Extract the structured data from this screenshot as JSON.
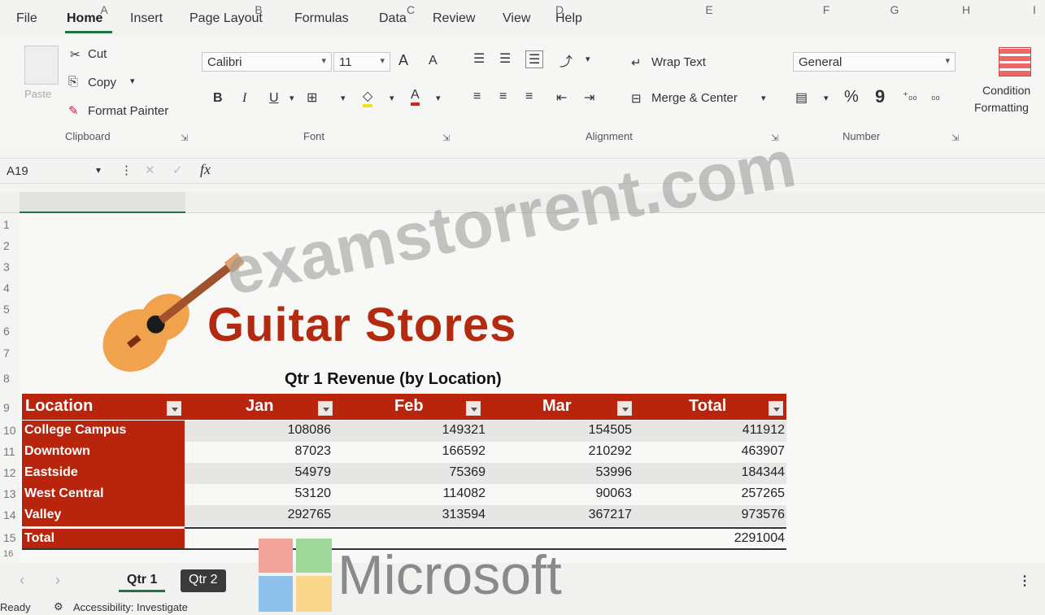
{
  "menu": {
    "items": [
      "File",
      "Home",
      "Insert",
      "Page Layout",
      "Formulas",
      "Data",
      "Review",
      "View",
      "Help"
    ]
  },
  "ribbon": {
    "clipboard": {
      "paste": "Paste",
      "cut": "Cut",
      "copy": "Copy",
      "format_painter": "Format Painter",
      "label": "Clipboard"
    },
    "font": {
      "name": "Calibri",
      "size": "11",
      "label": "Font",
      "bold": "B",
      "italic": "I",
      "underline": "U",
      "grow": "A",
      "shrink": "A"
    },
    "alignment": {
      "wrap_text": "Wrap Text",
      "merge_center": "Merge & Center",
      "label": "Alignment"
    },
    "number": {
      "format": "General",
      "percent": "%",
      "comma": "9",
      "label": "Number"
    },
    "conditional": {
      "line1": "Condition",
      "line2": "Formatting"
    }
  },
  "formula_bar": {
    "name_box": "A19",
    "fx": "fx",
    "value": ""
  },
  "columns": [
    "A",
    "B",
    "C",
    "D",
    "E",
    "F",
    "G",
    "H",
    "I"
  ],
  "rows": [
    "1",
    "2",
    "3",
    "4",
    "5",
    "6",
    "7",
    "8",
    "9",
    "10",
    "11",
    "12",
    "13",
    "14",
    "15",
    "16"
  ],
  "sheet": {
    "title": "Guitar Stores",
    "subtitle": "Qtr 1 Revenue (by Location)",
    "watermark": "examstorrent.com",
    "table": {
      "headers": [
        "Location",
        "Jan",
        "Feb",
        "Mar",
        "Total"
      ],
      "rows": [
        {
          "location": "College Campus",
          "jan": "108086",
          "feb": "149321",
          "mar": "154505",
          "total": "411912"
        },
        {
          "location": "Downtown",
          "jan": "87023",
          "feb": "166592",
          "mar": "210292",
          "total": "463907"
        },
        {
          "location": "Eastside",
          "jan": "54979",
          "feb": "75369",
          "mar": "53996",
          "total": "184344"
        },
        {
          "location": "West Central",
          "jan": "53120",
          "feb": "114082",
          "mar": "90063",
          "total": "257265"
        },
        {
          "location": "Valley",
          "jan": "292765",
          "feb": "313594",
          "mar": "367217",
          "total": "973576"
        }
      ],
      "total_label": "Total",
      "grand_total": "2291004"
    }
  },
  "tabs": [
    "Qtr 1",
    "Qtr 2"
  ],
  "status": {
    "ready": "Ready",
    "accessibility": "Accessibility: Investigate"
  },
  "brand": {
    "microsoft": "Microsoft"
  },
  "colors": {
    "table_header": "#b8240c",
    "title": "#b22a10",
    "accent": "#217346"
  }
}
